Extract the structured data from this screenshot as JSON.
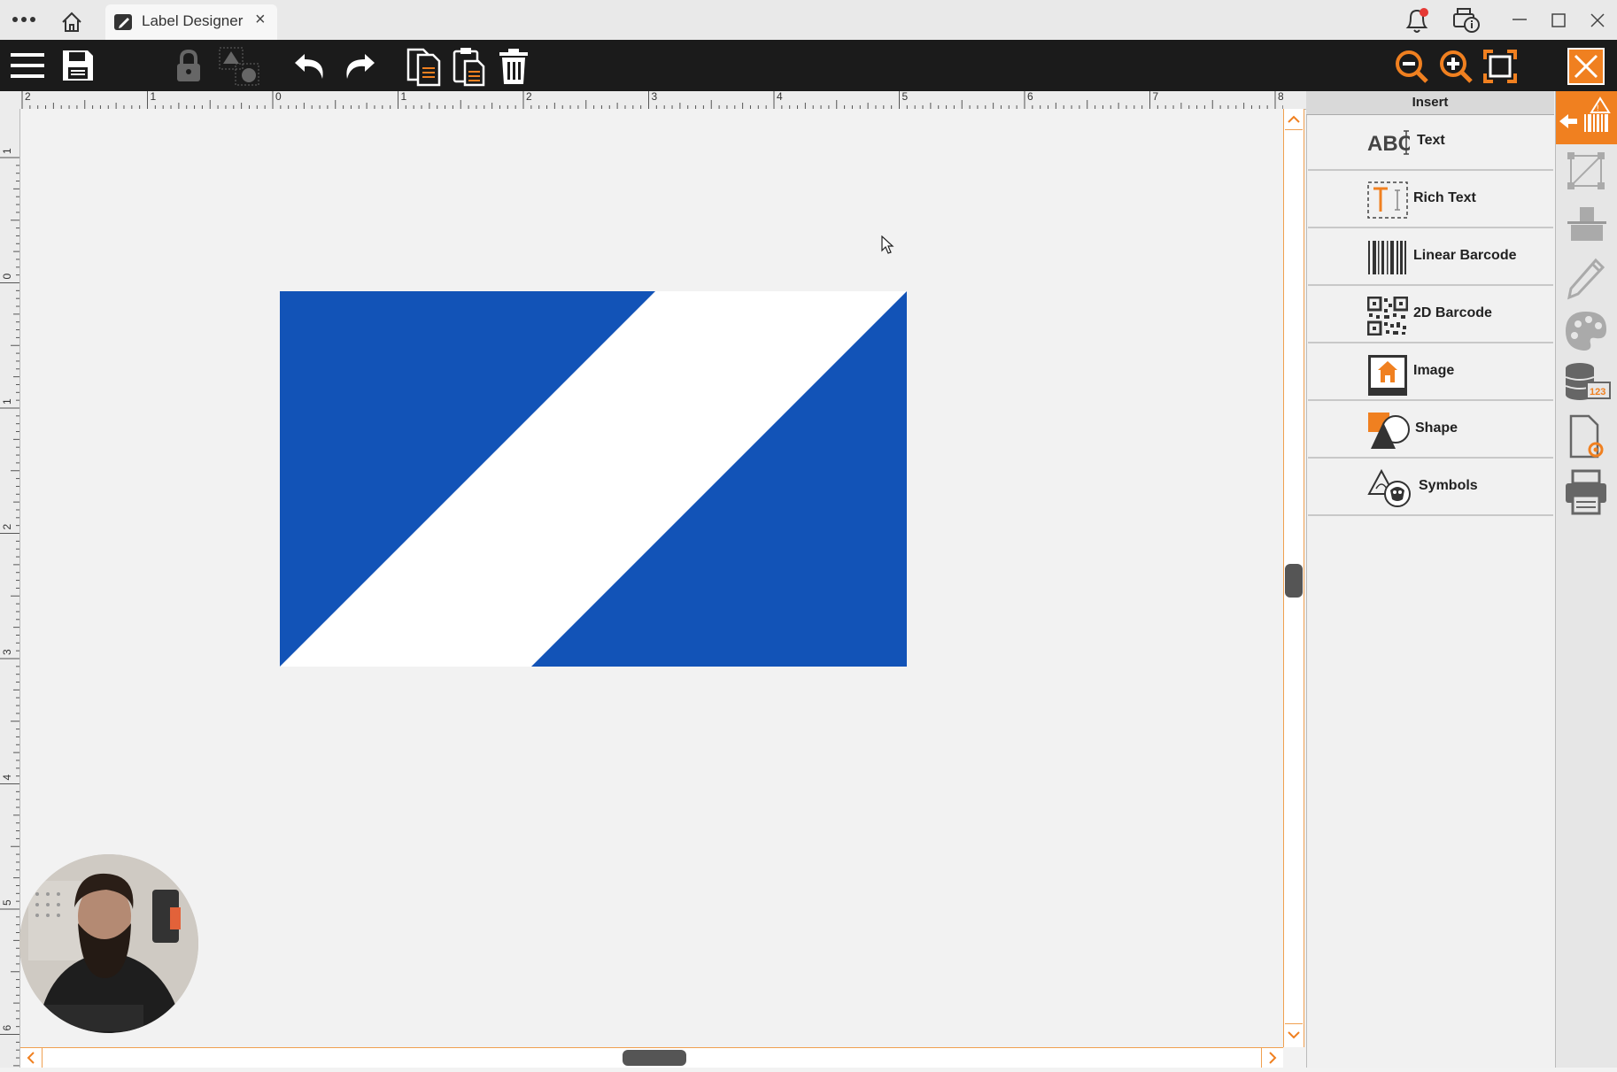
{
  "window": {
    "tab_title": "Label Designer",
    "tab_close": "×"
  },
  "insert_panel": {
    "header": "Insert",
    "items": [
      {
        "label": "Text"
      },
      {
        "label": "Rich Text"
      },
      {
        "label": "Linear Barcode"
      },
      {
        "label": "2D Barcode"
      },
      {
        "label": "Image"
      },
      {
        "label": "Shape"
      },
      {
        "label": "Symbols"
      }
    ]
  },
  "rulers": {
    "horizontal": [
      "2",
      "1",
      "0",
      "1",
      "2",
      "3",
      "4",
      "5",
      "6",
      "7",
      "8"
    ],
    "vertical": [
      "1",
      "0",
      "1",
      "2",
      "3",
      "4",
      "5",
      "6"
    ]
  },
  "colors": {
    "accent": "#f08020",
    "label_blue": "#1253b7",
    "toolbar_bg": "#1b1b1b"
  },
  "toolbar": {
    "left_icons": [
      "menu-icon",
      "save-icon",
      "lock-icon",
      "group-icon",
      "undo-icon",
      "redo-icon",
      "copy-icon",
      "paste-icon",
      "delete-icon"
    ],
    "right_icons": [
      "zoom-out-icon",
      "zoom-in-icon",
      "fit-icon",
      "close-icon"
    ]
  }
}
